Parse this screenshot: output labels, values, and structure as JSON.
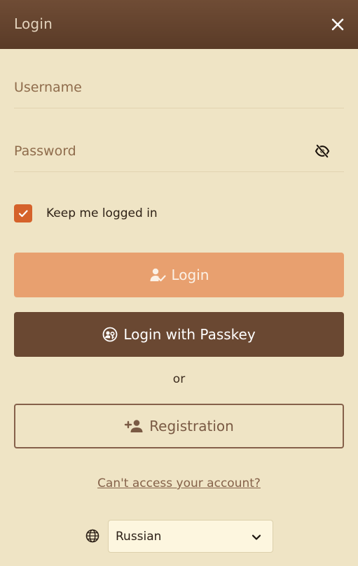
{
  "header": {
    "title": "Login",
    "close_icon": "close-icon"
  },
  "form": {
    "username_placeholder": "Username",
    "username_value": "",
    "password_placeholder": "Password",
    "password_value": "",
    "visibility_icon": "eye-slash-icon",
    "keep_logged_in": {
      "label": "Keep me logged in",
      "checked": true
    }
  },
  "buttons": {
    "login_label": "Login",
    "login_icon": "user-check-icon",
    "passkey_label": "Login with Passkey",
    "passkey_icon": "passkey-icon",
    "or_text": "or",
    "register_label": "Registration",
    "register_icon": "user-plus-icon"
  },
  "links": {
    "cant_access": "Can't access your account?"
  },
  "language": {
    "icon": "globe-icon",
    "selected": "Russian"
  },
  "colors": {
    "header_bg": "#5f3f2a",
    "background": "#efe4c5",
    "accent_orange": "#d5622b",
    "login_button": "#e8a06f",
    "passkey_button": "#6a4832",
    "outline_brown": "#85604a"
  }
}
